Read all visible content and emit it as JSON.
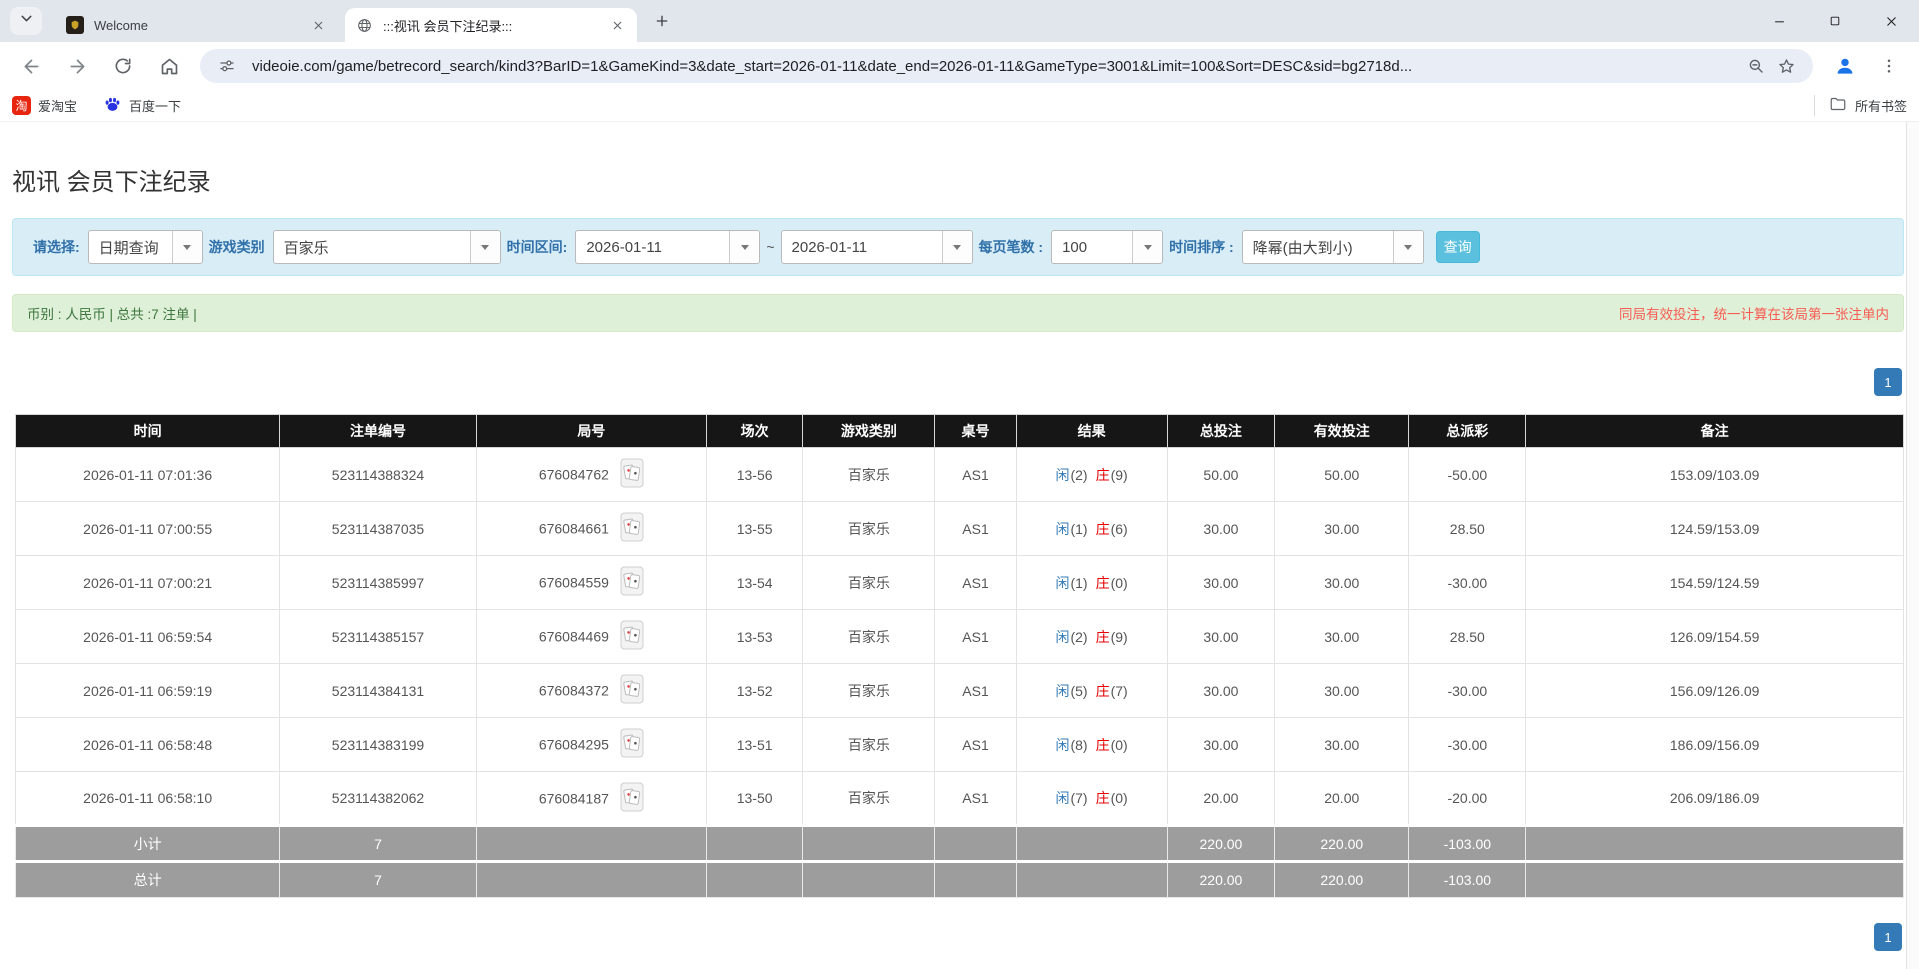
{
  "browser": {
    "tabs": [
      {
        "title": "Welcome"
      },
      {
        "title": ":::视讯 会员下注纪录:::"
      }
    ],
    "url": "videoie.com/game/betrecord_search/kind3?BarID=1&GameKind=3&date_start=2026-01-11&date_end=2026-01-11&GameType=3001&Limit=100&Sort=DESC&sid=bg2718d...",
    "bookmarks": {
      "taobao_glyph": "淘",
      "taobao": "爱淘宝",
      "baidu": "百度一下",
      "all_bookmarks": "所有书签"
    }
  },
  "page": {
    "title": "视讯 会员下注纪录",
    "filters": {
      "select_label": "请选择:",
      "select_value": "日期查询",
      "game_label": "游戏类别",
      "game_value": "百家乐",
      "range_label": "时间区间:",
      "date_start": "2026-01-11",
      "tilde": "~",
      "date_end": "2026-01-11",
      "per_page_label": "每页笔数 :",
      "per_page_value": "100",
      "sort_label": "时间排序 :",
      "sort_value": "降幂(由大到小)",
      "search_button": "查询"
    },
    "summary": {
      "left": "币别 : 人民币 | 总共 :7 注单 |",
      "right": "同局有效投注，统一计算在该局第一张注单内"
    },
    "pagination": {
      "page": "1"
    },
    "colors": {
      "accent_blue": "#337ab7",
      "negative_red": "#e60000",
      "panel_bg": "#d9edf7",
      "summary_bg": "#dff0d8",
      "header_bg": "#161616",
      "footer_bg": "#9d9d9d",
      "button_bg": "#5bc0de"
    },
    "table": {
      "headers": [
        "时间",
        "注单编号",
        "局号",
        "场次",
        "游戏类别",
        "桌号",
        "结果",
        "总投注",
        "有效投注",
        "总派彩",
        "备注"
      ],
      "rows": [
        {
          "time": "2026-01-11 07:01:36",
          "bet_id": "523114388324",
          "round_id": "676084762",
          "session": "13-56",
          "game": "百家乐",
          "table_no": "AS1",
          "p_label": "闲",
          "p_num": "(2)",
          "b_label": "庄",
          "b_num": "(9)",
          "total_bet": "50.00",
          "valid_bet": "50.00",
          "payout": "-50.00",
          "payout_class": "neg",
          "note": "153.09/103.09"
        },
        {
          "time": "2026-01-11 07:00:55",
          "bet_id": "523114387035",
          "round_id": "676084661",
          "session": "13-55",
          "game": "百家乐",
          "table_no": "AS1",
          "p_label": "闲",
          "p_num": "(1)",
          "b_label": "庄",
          "b_num": "(6)",
          "total_bet": "30.00",
          "valid_bet": "30.00",
          "payout": "28.50",
          "payout_class": "pos",
          "note": "124.59/153.09"
        },
        {
          "time": "2026-01-11 07:00:21",
          "bet_id": "523114385997",
          "round_id": "676084559",
          "session": "13-54",
          "game": "百家乐",
          "table_no": "AS1",
          "p_label": "闲",
          "p_num": "(1)",
          "b_label": "庄",
          "b_num": "(0)",
          "total_bet": "30.00",
          "valid_bet": "30.00",
          "payout": "-30.00",
          "payout_class": "neg",
          "note": "154.59/124.59"
        },
        {
          "time": "2026-01-11 06:59:54",
          "bet_id": "523114385157",
          "round_id": "676084469",
          "session": "13-53",
          "game": "百家乐",
          "table_no": "AS1",
          "p_label": "闲",
          "p_num": "(2)",
          "b_label": "庄",
          "b_num": "(9)",
          "total_bet": "30.00",
          "valid_bet": "30.00",
          "payout": "28.50",
          "payout_class": "pos",
          "note": "126.09/154.59"
        },
        {
          "time": "2026-01-11 06:59:19",
          "bet_id": "523114384131",
          "round_id": "676084372",
          "session": "13-52",
          "game": "百家乐",
          "table_no": "AS1",
          "p_label": "闲",
          "p_num": "(5)",
          "b_label": "庄",
          "b_num": "(7)",
          "total_bet": "30.00",
          "valid_bet": "30.00",
          "payout": "-30.00",
          "payout_class": "neg",
          "note": "156.09/126.09"
        },
        {
          "time": "2026-01-11 06:58:48",
          "bet_id": "523114383199",
          "round_id": "676084295",
          "session": "13-51",
          "game": "百家乐",
          "table_no": "AS1",
          "p_label": "闲",
          "p_num": "(8)",
          "b_label": "庄",
          "b_num": "(0)",
          "total_bet": "30.00",
          "valid_bet": "30.00",
          "payout": "-30.00",
          "payout_class": "neg",
          "note": "186.09/156.09"
        },
        {
          "time": "2026-01-11 06:58:10",
          "bet_id": "523114382062",
          "round_id": "676084187",
          "session": "13-50",
          "game": "百家乐",
          "table_no": "AS1",
          "p_label": "闲",
          "p_num": "(7)",
          "b_label": "庄",
          "b_num": "(0)",
          "total_bet": "20.00",
          "valid_bet": "20.00",
          "payout": "-20.00",
          "payout_class": "neg",
          "note": "206.09/186.09"
        }
      ],
      "footer": [
        {
          "label": "小计",
          "count": "7",
          "total_bet": "220.00",
          "valid_bet": "220.00",
          "payout": "-103.00"
        },
        {
          "label": "总计",
          "count": "7",
          "total_bet": "220.00",
          "valid_bet": "220.00",
          "payout": "-103.00"
        }
      ]
    }
  }
}
